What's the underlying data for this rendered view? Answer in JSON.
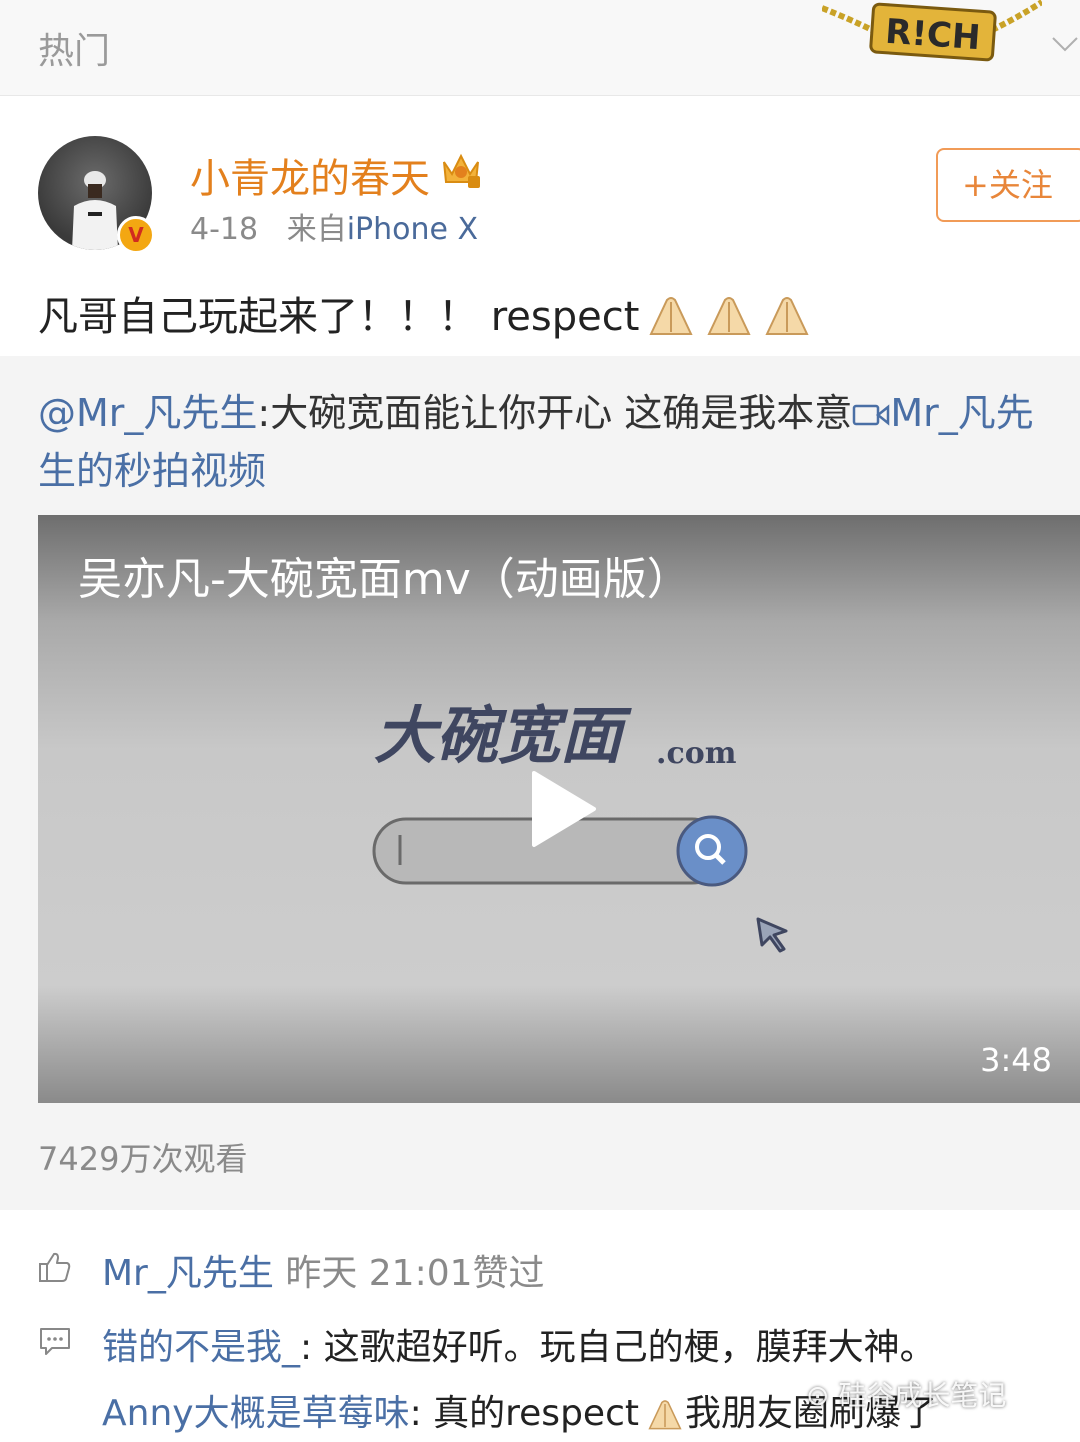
{
  "header": {
    "hot_label": "热门",
    "badge_text": "R!CH"
  },
  "post": {
    "username": "小青龙的春天",
    "date": "4-18",
    "source_prefix": "来自",
    "source_device": "iPhone X",
    "follow_label": "+关注",
    "text": "凡哥自己玩起来了！！！ respect",
    "verified_mark": "V"
  },
  "repost": {
    "mention": "@Mr_凡先生",
    "text": ":大碗宽面能让你开心 这确是我本意",
    "link_text": "Mr_凡先生的秒拍视频",
    "video": {
      "title": "吴亦凡-大碗宽面mv（动画版）",
      "logo_text": "大碗宽面",
      "logo_suffix": ".com",
      "duration": "3:48"
    },
    "views": "7429万次观看"
  },
  "likes": {
    "user": "Mr_凡先生",
    "time": "昨天 21:01",
    "suffix": "赞过"
  },
  "comments": [
    {
      "user": "错的不是我_",
      "text": ": 这歌超好听。玩自己的梗，膜拜大神。"
    },
    {
      "user": "Anny大概是草莓味",
      "text": ": 真的respect",
      "text2": "我朋友圈刷爆了"
    }
  ],
  "watermark": "硅谷成长笔记",
  "colors": {
    "accent_orange": "#e3801d",
    "link_blue": "#4a6fa5",
    "muted": "#8a8a8a"
  }
}
